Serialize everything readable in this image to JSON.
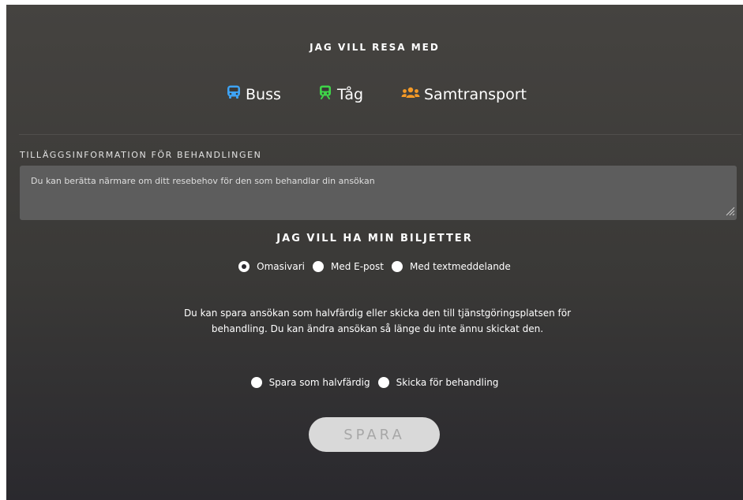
{
  "travel": {
    "heading": "JAG VILL RESA MED",
    "options": [
      {
        "label": "Buss",
        "icon": "bus-icon",
        "color": "#3ea3f4"
      },
      {
        "label": "Tåg",
        "icon": "train-icon",
        "color": "#3fd449"
      },
      {
        "label": "Samtransport",
        "icon": "users-icon",
        "color": "#f59a26"
      }
    ]
  },
  "extra_info": {
    "label": "TILLÄGGSINFORMATION FÖR BEHANDLINGEN",
    "placeholder": "Du kan berätta närmare om ditt resebehov för den som behandlar din ansökan"
  },
  "tickets": {
    "heading": "JAG VILL HA MIN BILJETTER",
    "options": [
      {
        "label": "Omasivari",
        "checked": true
      },
      {
        "label": "Med E-post",
        "checked": false
      },
      {
        "label": "Med textmeddelande",
        "checked": false
      }
    ]
  },
  "info_text": "Du kan spara ansökan som halvfärdig eller skicka den till tjänstgöringsplatsen för behandling. Du kan ändra ansökan så länge du inte ännu skickat den.",
  "submit": {
    "options": [
      {
        "label": "Spara som halvfärdig",
        "checked": false
      },
      {
        "label": "Skicka för behandling",
        "checked": false
      }
    ],
    "button_label": "SPARA"
  }
}
